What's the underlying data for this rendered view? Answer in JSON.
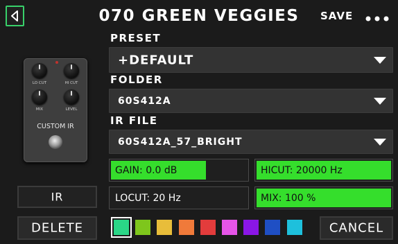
{
  "header": {
    "title": "070 GREEN VEGGIES",
    "save_label": "SAVE"
  },
  "pedal": {
    "knob_labels": [
      "LO CUT",
      "HI CUT",
      "MIX",
      "LEVEL"
    ],
    "name": "CUSTOM IR"
  },
  "preset": {
    "label": "PRESET",
    "value": "+DEFAULT"
  },
  "folder": {
    "label": "FOLDER",
    "value": "60S412A"
  },
  "ir_file": {
    "label": "IR FILE",
    "value": "60S412A_57_BRIGHT"
  },
  "params": {
    "gain": {
      "text": "GAIN: 0.0 dB",
      "fill": 0.7
    },
    "hicut": {
      "text": "HICUT: 20000 Hz",
      "fill": 1.0
    },
    "locut": {
      "text": "LOCUT: 20 Hz",
      "fill": 0.0
    },
    "mix": {
      "text": "MIX: 100 %",
      "fill": 1.0
    }
  },
  "buttons": {
    "ir": "IR",
    "delete": "DELETE",
    "cancel": "CANCEL"
  },
  "colors": {
    "accent": "#35de2c",
    "swatches": [
      "#2ad687",
      "#7ec61c",
      "#e8bd3a",
      "#f07a3a",
      "#e33c3c",
      "#e655e8",
      "#8a16e6",
      "#1f4fc4",
      "#1ec0dc"
    ],
    "selected_index": 0
  }
}
